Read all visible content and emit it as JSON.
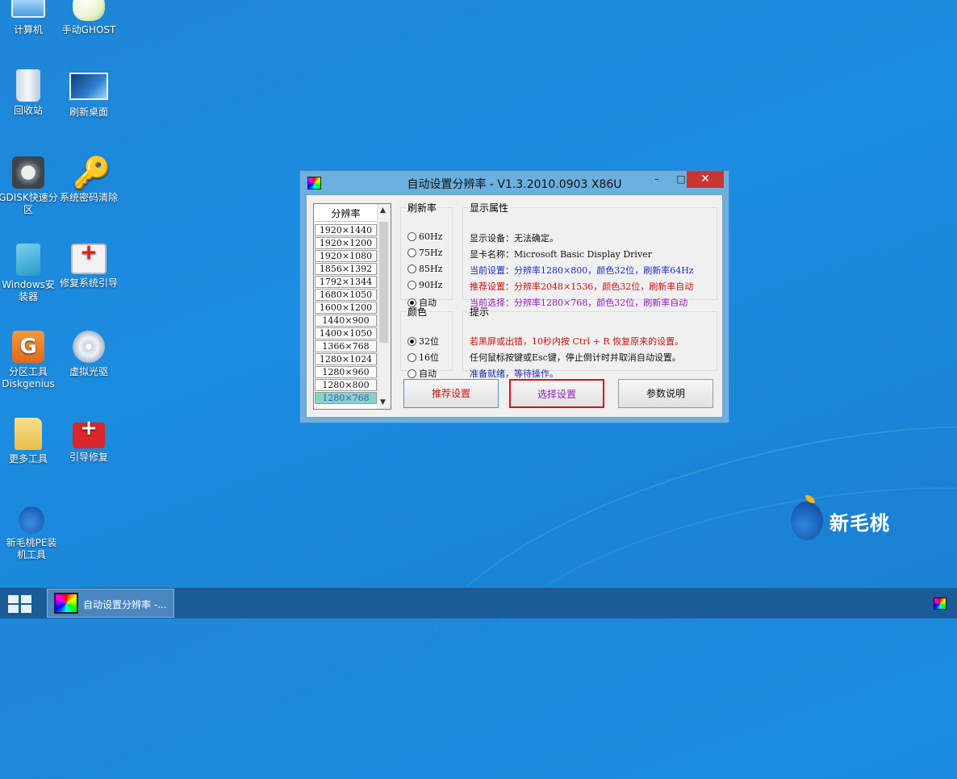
{
  "desktop": {
    "icons": [
      {
        "label": "计算机",
        "icon": "computer-icon"
      },
      {
        "label": "手动GHOST",
        "icon": "ghost-icon"
      },
      {
        "label": "回收站",
        "icon": "recycle-bin-icon"
      },
      {
        "label": "刷新桌面",
        "icon": "refresh-desktop-icon"
      },
      {
        "label": "GDISK快速分区",
        "icon": "gdisk-icon"
      },
      {
        "label": "系统密码清除",
        "icon": "key-icon"
      },
      {
        "label": "Windows安装器",
        "icon": "windows-installer-icon"
      },
      {
        "label": "修复系统引导",
        "icon": "first-aid-kit-icon"
      },
      {
        "label": "分区工具Diskgenius",
        "icon": "diskgenius-icon"
      },
      {
        "label": "虚拟光驱",
        "icon": "virtual-cd-icon"
      },
      {
        "label": "更多工具",
        "icon": "folder-icon"
      },
      {
        "label": "引导修复",
        "icon": "red-toolbox-icon"
      },
      {
        "label": "新毛桃PE装机工具",
        "icon": "peach-installer-icon"
      }
    ],
    "logo_text": "新毛桃"
  },
  "dialog": {
    "title": "自动设置分辨率 - V1.3.2010.0903 X86U",
    "minimize": "–",
    "maximize": "□",
    "close": "✕",
    "resolution_header": "分辨率",
    "resolutions": [
      "1920×1440",
      "1920×1200",
      "1920×1080",
      "1856×1392",
      "1792×1344",
      "1680×1050",
      "1600×1200",
      "1440×900",
      "1400×1050",
      "1366×768",
      "1280×1024",
      "1280×960",
      "1280×800",
      "1280×768"
    ],
    "selected_resolution": "1280×768",
    "refresh": {
      "legend": "刷新率",
      "options": [
        "60Hz",
        "75Hz",
        "85Hz",
        "90Hz",
        "自动"
      ],
      "selected": "自动"
    },
    "color": {
      "legend": "颜色",
      "options": [
        "32位",
        "16位",
        "自动"
      ],
      "selected": "32位"
    },
    "display_props": {
      "legend": "显示属性",
      "device": "显示设备：无法确定。",
      "card": "显卡名称：Microsoft Basic Display Driver",
      "current": "当前设置：分辨率1280×800，颜色32位，刷新率64Hz",
      "recommended": "推荐设置：分辨率2048×1536，颜色32位，刷新率自动",
      "selection": "当前选择：分辨率1280×768，颜色32位，刷新率自动"
    },
    "tips": {
      "legend": "提示",
      "line1": "若黑屏或出错，10秒内按 Ctrl + R 恢复原来的设置。",
      "line2": "任何鼠标按键或Esc键，停止倒计时并取消自动设置。",
      "line3": "准备就绪，等待操作。"
    },
    "buttons": {
      "recommend": "推荐设置",
      "select": "选择设置",
      "help": "参数说明"
    }
  },
  "taskbar": {
    "task_label": "自动设置分辨率 -..."
  }
}
